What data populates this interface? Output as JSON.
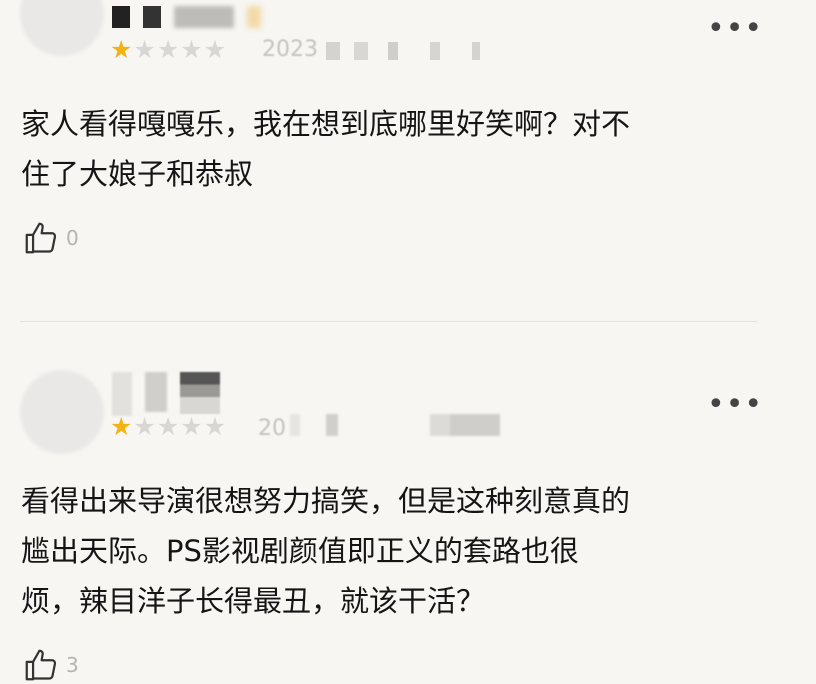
{
  "reviews": [
    {
      "username": "██名的",
      "rating": 1,
      "max_rating": 5,
      "date": "2023",
      "more_label": "•••",
      "text_lines": [
        "家人看得嘎嘎乐，我在想到底哪里好笑啊？对不",
        "住了大娘子和恭叔"
      ],
      "likes": "0"
    },
    {
      "username": "",
      "rating": 1,
      "max_rating": 5,
      "date": "20",
      "more_label": "•••",
      "text_lines": [
        "看得出来导演很想努力搞笑，但是这种刻意真的",
        "尴出天际。PS影视剧颜值即正义的套路也很",
        "烦，辣目洋子长得最丑，就该干活？"
      ],
      "likes": "3"
    }
  ]
}
